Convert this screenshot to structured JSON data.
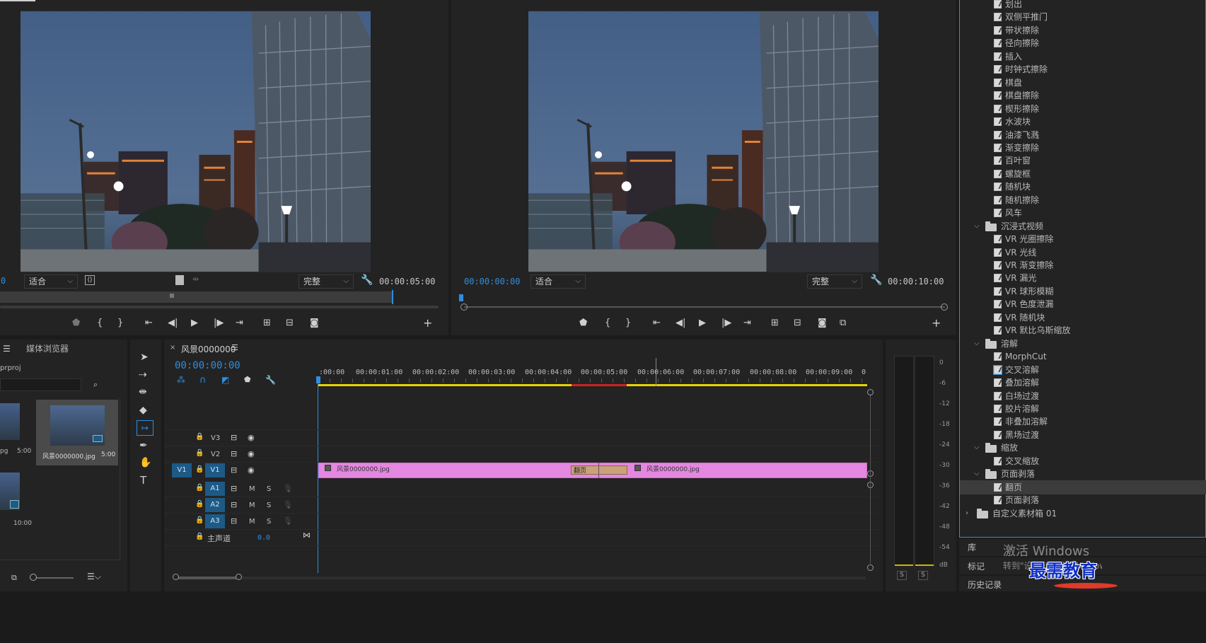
{
  "source_monitor": {
    "zoom_select": "适合",
    "quality_select": "完整",
    "duration": "00:00:05:00",
    "timecode_partial": "0"
  },
  "program_monitor": {
    "timecode": "00:00:00:00",
    "zoom_select": "适合",
    "quality_select": "完整",
    "duration": "00:00:10:00"
  },
  "project_panel": {
    "tab_media_browser": "媒体浏览器",
    "project_name": "prproj",
    "items": [
      {
        "name": "pg",
        "duration": "5:00"
      },
      {
        "name": "风景0000000.jpg",
        "duration": "5:00"
      },
      {
        "name": "",
        "duration": "10:00"
      }
    ]
  },
  "timeline": {
    "sequence_name": "风景0000000",
    "timecode": "00:00:00:00",
    "ruler": [
      ":00:00",
      "00:00:01:00",
      "00:00:02:00",
      "00:00:03:00",
      "00:00:04:00",
      "00:00:05:00",
      "00:00:06:00",
      "00:00:07:00",
      "00:00:08:00",
      "00:00:09:00",
      "0"
    ],
    "tracks": {
      "v3": "V3",
      "v2": "V2",
      "v1": "V1",
      "v1_source": "V1",
      "a1": "A1",
      "a2": "A2",
      "a3": "A3",
      "m": "M",
      "s": "S",
      "master": "主声道",
      "master_value": "0.0"
    },
    "clip1": "风景0000000.jpg",
    "clip2": "风景0000000.jpg",
    "transition": "翻页"
  },
  "meter": {
    "labels": [
      "0",
      "-6",
      "-12",
      "-18",
      "-24",
      "-30",
      "-36",
      "-42",
      "-48",
      "-54",
      "dB"
    ],
    "solo_left": "S",
    "solo_right": "S"
  },
  "effects": {
    "items_top": [
      "划出",
      "双侧平推门",
      "带状擦除",
      "径向擦除",
      "插入",
      "时钟式擦除",
      "棋盘",
      "棋盘擦除",
      "楔形擦除",
      "水波块",
      "油漆飞溅",
      "渐变擦除",
      "百叶窗",
      "螺旋框",
      "随机块",
      "随机擦除",
      "风车"
    ],
    "folder_immersive": "沉浸式视频",
    "items_vr": [
      "VR 光圈擦除",
      "VR 光线",
      "VR 渐变擦除",
      "VR 漏光",
      "VR 球形模糊",
      "VR 色度泄漏",
      "VR 随机块",
      "VR 默比乌斯缩放"
    ],
    "folder_dissolve": "溶解",
    "items_dissolve": [
      "MorphCut",
      "交叉溶解",
      "叠加溶解",
      "白场过渡",
      "胶片溶解",
      "非叠加溶解",
      "黑场过渡"
    ],
    "folder_zoom": "缩放",
    "items_zoom": [
      "交叉缩放"
    ],
    "folder_peel": "页面剥落",
    "items_peel": [
      "翻页",
      "页面剥落"
    ],
    "folder_custom": "自定义素材箱 01"
  },
  "bottom_panels": {
    "library": "库",
    "markers": "标记",
    "history": "历史记录",
    "watermark1": "激活 Windows",
    "watermark2": "转到\"设置\"以激活 Windows。",
    "logo_text": "最需教育"
  },
  "colors": {
    "accent_blue": "#2f8dde",
    "clip_pink": "#e487e0",
    "transition_tan": "#c9a27a",
    "worksheet_yellow": "#e8d200",
    "render_red": "#d02020"
  }
}
